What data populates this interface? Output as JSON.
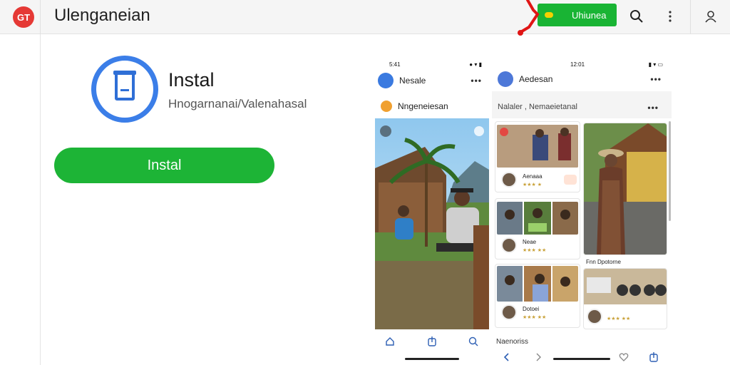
{
  "header": {
    "logo_text": "GT",
    "app_title": "Ulenganeian",
    "install_button_label": "Uhiunea",
    "search_icon": "search-icon",
    "more_icon": "more-vert-icon",
    "account_icon": "account-icon"
  },
  "hero": {
    "title": "Instal",
    "subtitle": "Hnogarnanai/Valenahasal",
    "install_label": "Instal"
  },
  "phone_left": {
    "time": "5:41",
    "app_name": "Nesale",
    "feed_title": "Nngeneiesan",
    "nav": [
      "home-icon",
      "share-icon",
      "search-icon"
    ]
  },
  "phone_right": {
    "time": "12:01",
    "app_name": "Aedesan",
    "filter_label": "Nalaler , Nemaeietanal",
    "left_cards": [
      {
        "name": "Aenaaa",
        "meta": "★★★ ★"
      },
      {
        "name": "Neae",
        "meta": "★★★ ★★"
      },
      {
        "name": "Dotoei",
        "meta": "★★★ ★★"
      }
    ],
    "right_card_caption": "Fnn Dpotorne",
    "footer_label": "Naenoriss",
    "nav": [
      "back-icon",
      "forward-icon",
      "heart-icon",
      "share-icon"
    ]
  },
  "colors": {
    "brand_red": "#e53935",
    "install_green": "#1db436",
    "accent_blue": "#3b7ee8"
  }
}
